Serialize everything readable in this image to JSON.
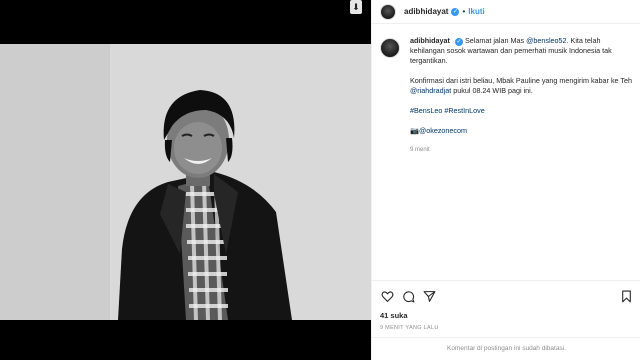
{
  "post": {
    "username": "adibhidayat",
    "follow_label": "Ikuti",
    "separator": "•"
  },
  "caption": {
    "line1_prefix": "Selamat jalan Mas ",
    "line1_mention": "@bensleo52",
    "line1_suffix": ". Kita telah kehilangan sosok wartawan dan pemerhati musik Indonesia tak tergantikan.",
    "para2_prefix": "Konfirmasi dari istri beliau, Mbak Pauline yang mengirim kabar ke Teh ",
    "para2_mention": "@riahdradjat",
    "para2_suffix": " pukul 08.24 WIB pagi ini.",
    "hashtags": "#BensLeo #RestInLove",
    "credit_icon": "📷",
    "credit": "@okezonecom",
    "time": "9 menit"
  },
  "stats": {
    "likes": "41 suka",
    "ago": "9 MENIT YANG LALU"
  },
  "footer": {
    "comments_closed": "Komentar di postingan ini sudah dibatasi."
  },
  "icons": {
    "heart": "heart-icon",
    "comment": "comment-icon",
    "share": "share-icon",
    "bookmark": "bookmark-icon",
    "save": "save-icon"
  }
}
